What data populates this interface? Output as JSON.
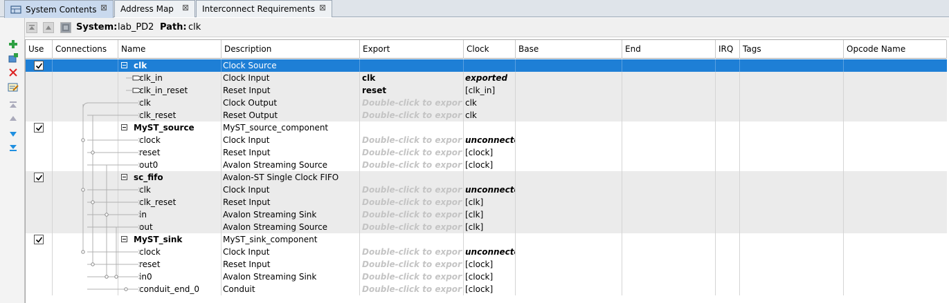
{
  "tabs": [
    {
      "label": "System Contents",
      "close": "⊠",
      "active": true
    },
    {
      "label": "Address Map",
      "close": "⊠",
      "active": false
    },
    {
      "label": "Interconnect Requirements",
      "close": "⊠",
      "active": false
    }
  ],
  "pathbar": {
    "system_label": "System:",
    "system_value": "lab_PD2",
    "path_label": "Path:",
    "path_value": "clk"
  },
  "toolbar": {
    "icons": [
      "add-icon",
      "add-connection-icon",
      "remove-icon",
      "edit-icon",
      "move-top-icon",
      "move-up-icon",
      "move-down-icon",
      "move-bottom-icon"
    ]
  },
  "columns": [
    "Use",
    "Connections",
    "Name",
    "Description",
    "Export",
    "Clock",
    "Base",
    "End",
    "IRQ",
    "Tags",
    "Opcode Name"
  ],
  "export_hint": "Double-click to export",
  "rows": [
    {
      "kind": "component",
      "use": true,
      "name": "clk",
      "description": "Clock Source",
      "export": "",
      "clock": "",
      "selected": true
    },
    {
      "kind": "interface",
      "name": "clk_in",
      "description": "Clock Input",
      "export": "clk",
      "export_style": "bold",
      "clock": "exported",
      "clock_style": "italic"
    },
    {
      "kind": "interface",
      "name": "clk_in_reset",
      "description": "Reset Input",
      "export": "reset",
      "export_style": "bold",
      "clock": "[clk_in]"
    },
    {
      "kind": "interface",
      "name": "clk",
      "description": "Clock Output",
      "export": "Double-click to export",
      "export_style": "hint",
      "clock": "clk"
    },
    {
      "kind": "interface",
      "name": "clk_reset",
      "description": "Reset Output",
      "export": "Double-click to export",
      "export_style": "hint",
      "clock": "clk"
    },
    {
      "kind": "component",
      "use": true,
      "name": "MyST_source",
      "description": "MyST_source_component",
      "export": "",
      "clock": ""
    },
    {
      "kind": "interface",
      "name": "clock",
      "description": "Clock Input",
      "export": "Double-click to export",
      "export_style": "hint",
      "clock": "unconnected",
      "clock_style": "italic"
    },
    {
      "kind": "interface",
      "name": "reset",
      "description": "Reset Input",
      "export": "Double-click to export",
      "export_style": "hint",
      "clock": "[clock]"
    },
    {
      "kind": "interface",
      "name": "out0",
      "description": "Avalon Streaming Source",
      "export": "Double-click to export",
      "export_style": "hint",
      "clock": "[clock]"
    },
    {
      "kind": "component",
      "use": true,
      "name": "sc_fifo",
      "description": "Avalon-ST Single Clock FIFO",
      "export": "",
      "clock": ""
    },
    {
      "kind": "interface",
      "name": "clk",
      "description": "Clock Input",
      "export": "Double-click to export",
      "export_style": "hint",
      "clock": "unconnected",
      "clock_style": "italic"
    },
    {
      "kind": "interface",
      "name": "clk_reset",
      "description": "Reset Input",
      "export": "Double-click to export",
      "export_style": "hint",
      "clock": "[clk]"
    },
    {
      "kind": "interface",
      "name": "in",
      "description": "Avalon Streaming Sink",
      "export": "Double-click to export",
      "export_style": "hint",
      "clock": "[clk]"
    },
    {
      "kind": "interface",
      "name": "out",
      "description": "Avalon Streaming Source",
      "export": "Double-click to export",
      "export_style": "hint",
      "clock": "[clk]"
    },
    {
      "kind": "component",
      "use": true,
      "name": "MyST_sink",
      "description": "MyST_sink_component",
      "export": "",
      "clock": ""
    },
    {
      "kind": "interface",
      "name": "clock",
      "description": "Clock Input",
      "export": "Double-click to export",
      "export_style": "hint",
      "clock": "unconnected",
      "clock_style": "italic"
    },
    {
      "kind": "interface",
      "name": "reset",
      "description": "Reset Input",
      "export": "Double-click to export",
      "export_style": "hint",
      "clock": "[clock]"
    },
    {
      "kind": "interface",
      "name": "in0",
      "description": "Avalon Streaming Sink",
      "export": "Double-click to export",
      "export_style": "hint",
      "clock": "[clock]"
    },
    {
      "kind": "interface",
      "name": "conduit_end_0",
      "description": "Conduit",
      "export": "Double-click to export",
      "export_style": "hint",
      "clock": "[clock]"
    }
  ],
  "colors": {
    "selection": "#1e7fd6",
    "alt_row": "#ebebeb",
    "hint_text": "#c4c4c4",
    "tab_active": "#c9d9ee"
  }
}
